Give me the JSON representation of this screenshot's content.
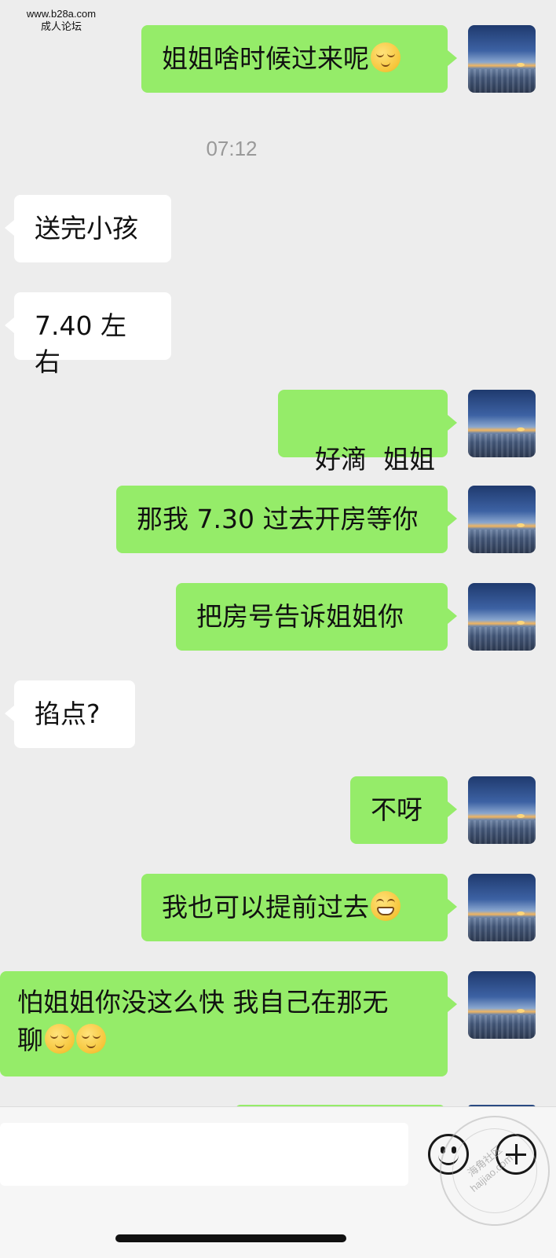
{
  "watermark": {
    "site": "www.b28a.com",
    "forum": "成人论坛"
  },
  "timestamp": "07:12",
  "messages": [
    {
      "id": "m1",
      "side": "sent",
      "text": "姐姐啥时候过来呢",
      "emoji": [
        "smiling-face-with-closed-eyes"
      ]
    },
    {
      "id": "m2",
      "side": "recv",
      "text": "送完小孩"
    },
    {
      "id": "m3",
      "side": "recv",
      "text": "7.40 左右"
    },
    {
      "id": "m4",
      "side": "sent",
      "text": "好滴  姐姐"
    },
    {
      "id": "m5",
      "side": "sent",
      "text": "那我 7.30 过去开房等你"
    },
    {
      "id": "m6",
      "side": "sent",
      "text": "把房号告诉姐姐你"
    },
    {
      "id": "m7",
      "side": "recv",
      "text": "掐点?"
    },
    {
      "id": "m8",
      "side": "sent",
      "text": "不呀"
    },
    {
      "id": "m9",
      "side": "sent",
      "text": "我也可以提前过去",
      "emoji": [
        "grinning-face"
      ]
    },
    {
      "id": "m10",
      "side": "sent",
      "text": "怕姐姐你没这么快 我自己在那无",
      "text2": "聊",
      "emoji": [
        "smiling-face-with-closed-eyes",
        "smiling-face-with-closed-eyes"
      ]
    }
  ],
  "input_bar": {
    "input_value": "",
    "emoji_icon": "emoji-face-icon",
    "plus_icon": "plus-circle-icon"
  },
  "stamp": {
    "line1": "海角社区",
    "line2": "haijiao.com"
  },
  "colors": {
    "background": "#ededed",
    "sent_bubble": "#95ec69",
    "recv_bubble": "#ffffff",
    "timestamp": "#999999"
  }
}
